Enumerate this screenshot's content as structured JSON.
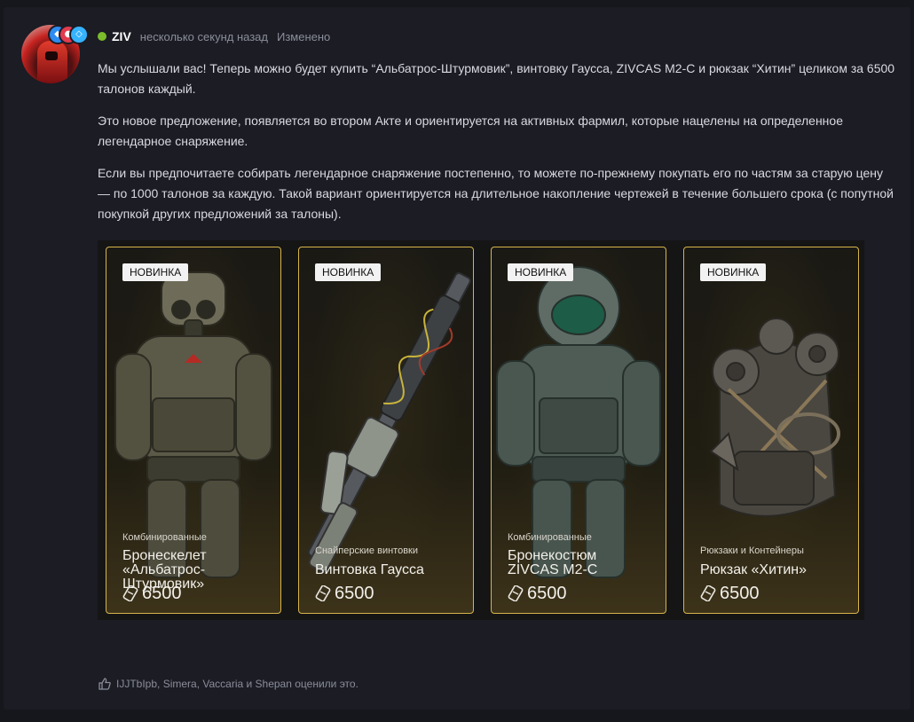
{
  "post": {
    "username": "ZIV",
    "time": "несколько секунд назад",
    "edited": "Изменено",
    "paragraphs": [
      "Мы услышали вас! Теперь можно будет купить “Альбатрос-Штурмовик”, винтовку Гаусса, ZIVCAS M2-C и рюкзак “Хитин” целиком за 6500 талонов каждый.",
      "Это новое предложение, появляется во втором Акте и ориентируется на активных фармил, которые нацелены на определенное легендарное снаряжение.",
      "Если вы предпочитаете собирать легендарное снаряжение постепенно, то можете по-прежнему покупать его по частям за старую цену — по 1000 талонов за каждую. Такой вариант ориентируется на длительное накопление чертежей в течение большего срока (с попутной покупкой других предложений за талоны)."
    ]
  },
  "cards": [
    {
      "tag": "НОВИНКА",
      "category": "Комбинированные",
      "name": "Бронескелет «Альбатрос-Штурмовик»",
      "price": "6500",
      "icon": "armor-illustration"
    },
    {
      "tag": "НОВИНКА",
      "category": "Снайперские винтовки",
      "name": "Винтовка Гаусса",
      "price": "6500",
      "icon": "rifle-illustration"
    },
    {
      "tag": "НОВИНКА",
      "category": "Комбинированные",
      "name": "Бронекостюм ZIVCAS M2-C",
      "price": "6500",
      "icon": "armor-illustration"
    },
    {
      "tag": "НОВИНКА",
      "category": "Рюкзаки и Контейнеры",
      "name": "Рюкзак «Хитин»",
      "price": "6500",
      "icon": "backpack-illustration"
    }
  ],
  "likes": {
    "text": "IJJTbIpb, Simera, Vaccaria и Shepan оценили это.",
    "icon": "thumbs-up-icon"
  },
  "colors": {
    "background": "#16171d",
    "panel": "#1b1c24",
    "card_border": "#d7b44a",
    "online": "#7bbd2a",
    "muted": "#8a8d99"
  }
}
